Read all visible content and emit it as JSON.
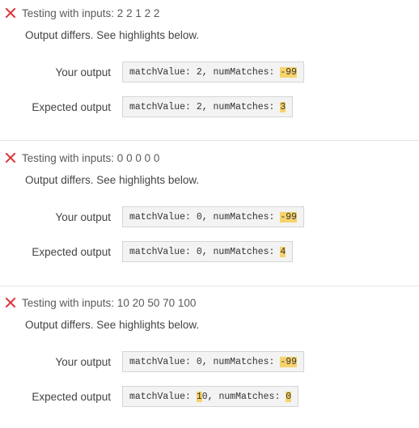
{
  "colors": {
    "fail_x": "#d9363e",
    "highlight": "#f7d36b",
    "box_bg": "#f3f3f3",
    "box_border": "#d5d5d5"
  },
  "tests": [
    {
      "header": "Testing with inputs: 2 2 1 2 2",
      "status": "Output differs. See highlights below.",
      "your_label": "Your output",
      "expected_label": "Expected output",
      "your_output": {
        "prefix": "matchValue: 2, numMatches: ",
        "hl1": "-99",
        "mid": "",
        "hl2": "",
        "suffix": ""
      },
      "expected_output": {
        "prefix": "matchValue: 2, numMatches: ",
        "hl1": "3",
        "mid": "",
        "hl2": "",
        "suffix": ""
      }
    },
    {
      "header": "Testing with inputs: 0 0 0 0 0",
      "status": "Output differs. See highlights below.",
      "your_label": "Your output",
      "expected_label": "Expected output",
      "your_output": {
        "prefix": "matchValue: 0, numMatches: ",
        "hl1": "-99",
        "mid": "",
        "hl2": "",
        "suffix": ""
      },
      "expected_output": {
        "prefix": "matchValue: 0, numMatches: ",
        "hl1": "4",
        "mid": "",
        "hl2": "",
        "suffix": ""
      }
    },
    {
      "header": "Testing with inputs: 10 20 50 70 100",
      "status": "Output differs. See highlights below.",
      "your_label": "Your output",
      "expected_label": "Expected output",
      "your_output": {
        "prefix": "matchValue: 0, numMatches: ",
        "hl1": "-99",
        "mid": "",
        "hl2": "",
        "suffix": ""
      },
      "expected_output": {
        "prefix": "matchValue: ",
        "hl1": "1",
        "mid": "0, numMatches: ",
        "hl2": "0",
        "suffix": ""
      }
    }
  ]
}
